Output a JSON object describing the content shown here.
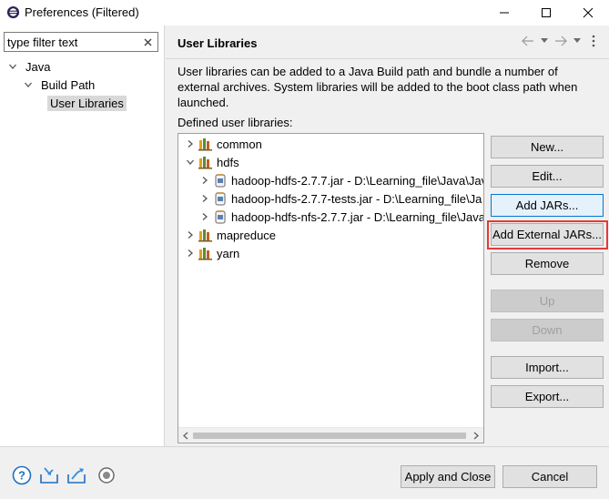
{
  "window": {
    "title": "Preferences (Filtered)"
  },
  "left": {
    "filter_placeholder": "type filter text",
    "tree": [
      {
        "label": "Java",
        "expanded": true
      },
      {
        "label": "Build Path",
        "expanded": true
      },
      {
        "label": "User Libraries",
        "selected": true
      }
    ]
  },
  "page": {
    "title": "User Libraries",
    "description": "User libraries can be added to a Java Build path and bundle a number of external archives. System libraries will be added to the boot class path when launched.",
    "defined_label": "Defined user libraries:"
  },
  "libraries": [
    {
      "name": "common",
      "expanded": false
    },
    {
      "name": "hdfs",
      "expanded": true,
      "jars": [
        "hadoop-hdfs-2.7.7.jar - D:\\Learning_file\\Java\\Jav",
        "hadoop-hdfs-2.7.7-tests.jar - D:\\Learning_file\\Ja",
        "hadoop-hdfs-nfs-2.7.7.jar - D:\\Learning_file\\Java"
      ]
    },
    {
      "name": "mapreduce",
      "expanded": false
    },
    {
      "name": "yarn",
      "expanded": false
    }
  ],
  "buttons": {
    "new": "New...",
    "edit": "Edit...",
    "add_jars": "Add JARs...",
    "add_external_jars": "Add External JARs...",
    "remove": "Remove",
    "up": "Up",
    "down": "Down",
    "import": "Import...",
    "export": "Export..."
  },
  "dialog": {
    "apply_close": "Apply and Close",
    "cancel": "Cancel"
  },
  "icons": {
    "help": "help-icon",
    "import_prefs": "import-preferences-icon",
    "export_prefs": "export-preferences-icon",
    "oomph": "record-icon"
  },
  "colors": {
    "highlight": "#e53935",
    "focus": "#0078d7",
    "help_blue": "#1e6fbf"
  }
}
